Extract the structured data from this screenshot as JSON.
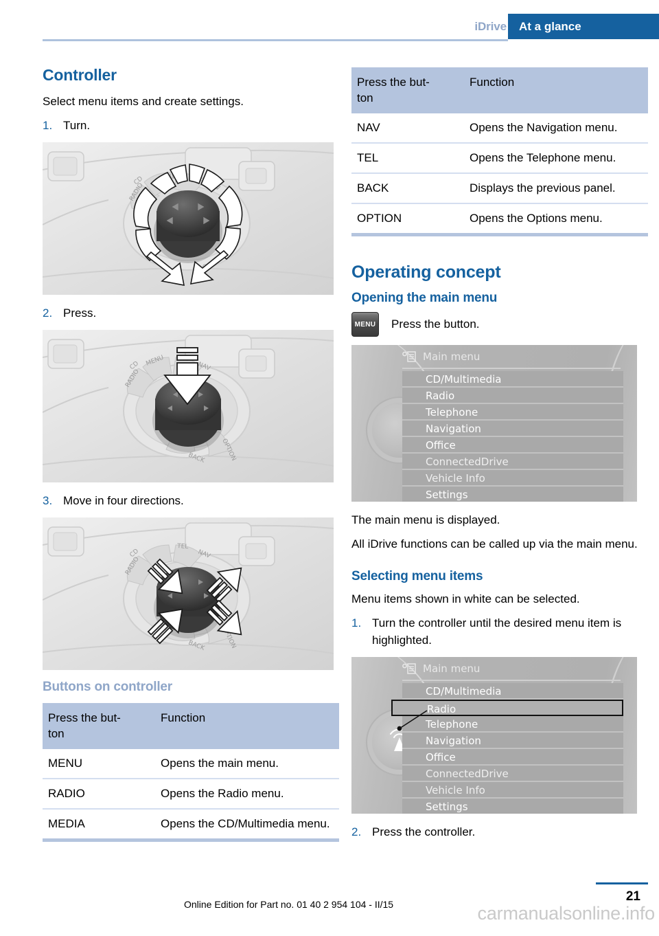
{
  "header": {
    "tab_secondary": "iDrive",
    "tab_primary": "At a glance"
  },
  "left_column": {
    "controller": {
      "title": "Controller",
      "intro": "Select menu items and create settings.",
      "steps": [
        {
          "num": "1.",
          "text": "Turn."
        },
        {
          "num": "2.",
          "text": "Press."
        },
        {
          "num": "3.",
          "text": "Move in four directions."
        }
      ],
      "figures": [
        {
          "name": "controller-turn-photo",
          "caption_ref": "1."
        },
        {
          "name": "controller-press-photo",
          "caption_ref": "2."
        },
        {
          "name": "controller-move-photo",
          "caption_ref": "3."
        }
      ]
    },
    "buttons_on_controller": {
      "title": "Buttons on controller",
      "table": {
        "headers": [
          "Press the but-\nton",
          "Function"
        ],
        "header_col1": "Press the but-",
        "header_col1_b": "ton",
        "header_col2": "Function",
        "rows": [
          {
            "button": "MENU",
            "function": "Opens the main menu."
          },
          {
            "button": "RADIO",
            "function": "Opens the Radio menu."
          },
          {
            "button": "MEDIA",
            "function": "Opens the CD/Multimedia menu."
          }
        ]
      }
    }
  },
  "right_column": {
    "table_top": {
      "header_col1": "Press the but-",
      "header_col1_b": "ton",
      "header_col2": "Function",
      "rows": [
        {
          "button": "NAV",
          "function": "Opens the Navigation menu."
        },
        {
          "button": "TEL",
          "function": "Opens the Telephone menu."
        },
        {
          "button": "BACK",
          "function": "Displays the previous panel."
        },
        {
          "button": "OPTION",
          "function": "Opens the Options menu."
        }
      ]
    },
    "operating_concept": {
      "title": "Operating concept",
      "opening_main_menu": {
        "title": "Opening the main menu",
        "key_label": "MENU",
        "key_instruction": "Press the button.",
        "after_text_1": "The main menu is displayed.",
        "after_text_2": "All iDrive functions can be called up via the main menu."
      },
      "selecting_menu_items": {
        "title": "Selecting menu items",
        "intro": "Menu items shown in white can be selected.",
        "steps": [
          {
            "num": "1.",
            "text": "Turn the controller until the desired menu item is highlighted."
          },
          {
            "num": "2.",
            "text": "Press the controller."
          }
        ]
      }
    },
    "cid_screen_1": {
      "title": "Main menu",
      "items": [
        "CD/Multimedia",
        "Radio",
        "Telephone",
        "Navigation",
        "Office",
        "ConnectedDrive",
        "Vehicle Info",
        "Settings"
      ],
      "highlighted": null
    },
    "cid_screen_2": {
      "title": "Main menu",
      "items": [
        "CD/Multimedia",
        "Radio",
        "Telephone",
        "Navigation",
        "Office",
        "ConnectedDrive",
        "Vehicle Info",
        "Settings"
      ],
      "highlighted": "Radio"
    }
  },
  "footer": {
    "note": "Online Edition for Part no. 01 40 2 954 104 - II/15",
    "page_number": "21",
    "watermark": "carmanualsonline.info"
  },
  "colors": {
    "brand_blue": "#15619f",
    "light_blue": "#8fa6c8",
    "table_header": "#b4c4de",
    "table_rule": "#d4def0"
  }
}
